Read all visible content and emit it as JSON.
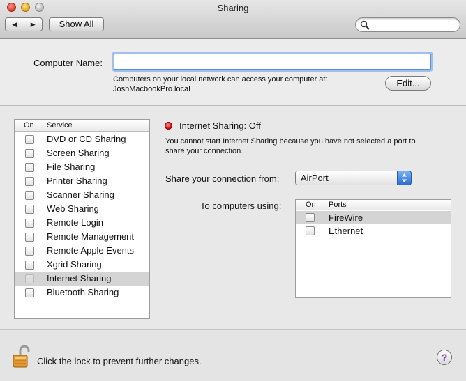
{
  "window": {
    "title": "Sharing"
  },
  "toolbar": {
    "back_glyph": "◀",
    "forward_glyph": "▶",
    "show_all_label": "Show All",
    "search_placeholder": "",
    "search_value": ""
  },
  "computer_name": {
    "label": "Computer Name:",
    "value": "",
    "help_line1": "Computers on your local network can access your computer at:",
    "help_line2": "JoshMacbookPro.local",
    "edit_label": "Edit..."
  },
  "services": {
    "header_on": "On",
    "header_service": "Service",
    "items": [
      {
        "label": "DVD or CD Sharing",
        "checked": false
      },
      {
        "label": "Screen Sharing",
        "checked": false
      },
      {
        "label": "File Sharing",
        "checked": false
      },
      {
        "label": "Printer Sharing",
        "checked": false
      },
      {
        "label": "Scanner Sharing",
        "checked": false
      },
      {
        "label": "Web Sharing",
        "checked": false
      },
      {
        "label": "Remote Login",
        "checked": false
      },
      {
        "label": "Remote Management",
        "checked": false
      },
      {
        "label": "Remote Apple Events",
        "checked": false
      },
      {
        "label": "Xgrid Sharing",
        "checked": false
      },
      {
        "label": "Internet Sharing",
        "checked": false,
        "selected": true
      },
      {
        "label": "Bluetooth Sharing",
        "checked": false
      }
    ]
  },
  "detail": {
    "status_text": "Internet Sharing: Off",
    "status_color": "#d10c0c",
    "description_line1": "You cannot start Internet Sharing because you have not selected a port to",
    "description_line2": "share your connection.",
    "share_from_label": "Share your connection from:",
    "share_from_value": "AirPort",
    "to_computers_label": "To computers using:",
    "ports_header_on": "On",
    "ports_header_ports": "Ports",
    "ports": [
      {
        "label": "FireWire",
        "checked": false,
        "selected": true
      },
      {
        "label": "Ethernet",
        "checked": false
      }
    ]
  },
  "footer": {
    "lock_text": "Click the lock to prevent further changes.",
    "help_glyph": "?"
  },
  "icons": [
    "search-icon",
    "lock-icon",
    "chevron-updown-icon"
  ]
}
